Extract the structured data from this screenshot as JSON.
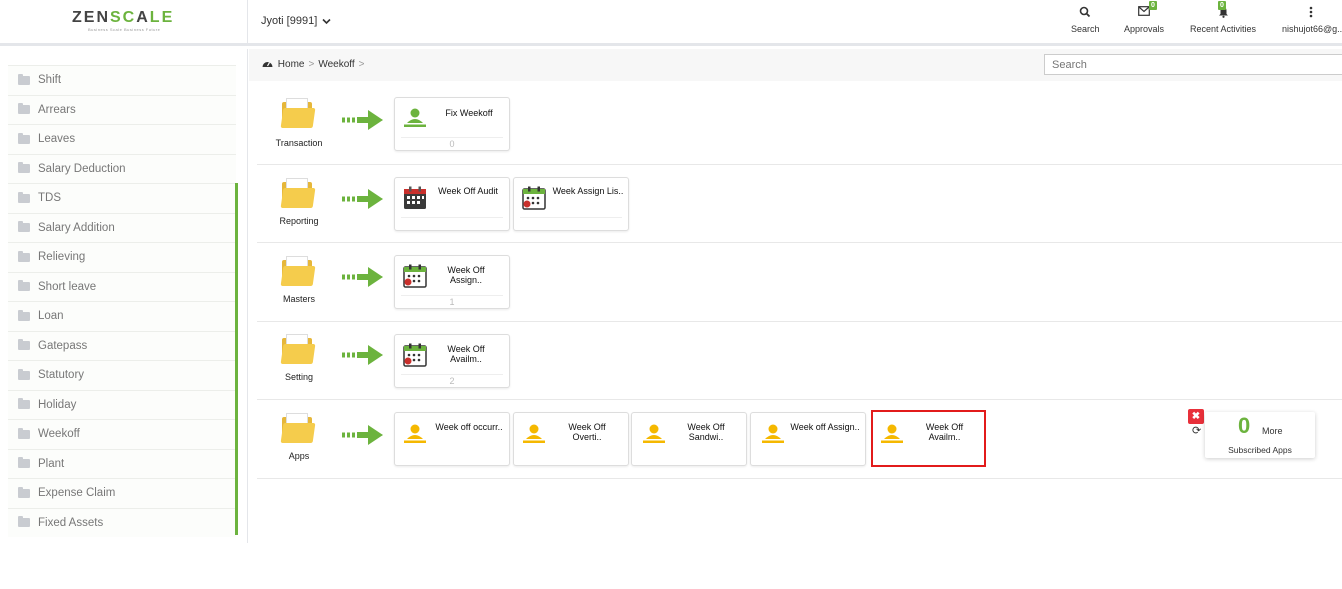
{
  "header": {
    "logo": {
      "text_a": "ZEN",
      "text_b": "SC",
      "text_c": "A",
      "text_d": "LE",
      "tagline": "Business Scale Business Future"
    },
    "user_select": "Jyoti [9991]",
    "items": [
      {
        "label": "Search",
        "icon": "search-icon"
      },
      {
        "label": "Approvals",
        "icon": "envelope-icon",
        "badge": "0"
      },
      {
        "label": "Recent Activities",
        "icon": "bell-icon",
        "badge": "0"
      },
      {
        "label": "nishujot66@g..",
        "icon": "kebab-icon"
      }
    ]
  },
  "sidebar": {
    "items": [
      "Shift",
      "Arrears",
      "Leaves",
      "Salary Deduction",
      "TDS",
      "Salary Addition",
      "Relieving",
      "Short leave",
      "Loan",
      "Gatepass",
      "Statutory",
      "Holiday",
      "Weekoff",
      "Plant",
      "Expense Claim",
      "Fixed Assets"
    ]
  },
  "breadcrumb": {
    "home": "Home",
    "current": "Weekoff",
    "sep": ">"
  },
  "search": {
    "placeholder": "Search"
  },
  "rows": [
    {
      "label": "Transaction",
      "tiles": [
        {
          "name": "Fix Weekoff",
          "count": "0",
          "icon": "person-icon",
          "color": "#6cb33e"
        }
      ]
    },
    {
      "label": "Reporting",
      "tiles": [
        {
          "name": "Week Off Audit",
          "icon": "calendar-icon"
        },
        {
          "name": "Week Assign Lis..",
          "icon": "calendar-icon"
        }
      ]
    },
    {
      "label": "Masters",
      "tiles": [
        {
          "name": "Week Off Assign..",
          "count": "1",
          "icon": "calendar-icon"
        }
      ]
    },
    {
      "label": "Setting",
      "tiles": [
        {
          "name": "Week Off Availm..",
          "count": "2",
          "icon": "calendar-icon"
        }
      ]
    },
    {
      "label": "Apps",
      "tiles": [
        {
          "name": "Week off occurr..",
          "icon": "person-icon",
          "color": "#f5b800"
        },
        {
          "name": "Week Off Overti..",
          "icon": "person-icon",
          "color": "#f5b800"
        },
        {
          "name": "Week Off Sandwi..",
          "icon": "person-icon",
          "color": "#f5b800"
        },
        {
          "name": "Week off Assign..",
          "icon": "person-icon",
          "color": "#f5b800"
        },
        {
          "name": "Week Off Availm..",
          "icon": "person-icon",
          "color": "#f5b800"
        }
      ]
    }
  ],
  "subscribed": {
    "count": "0",
    "more": "More",
    "label": "Subscribed Apps"
  },
  "colors": {
    "accent": "#6cb33e",
    "folder": "#f5cc4c",
    "selected_border": "#e21b1b",
    "close": "#e8303a"
  }
}
